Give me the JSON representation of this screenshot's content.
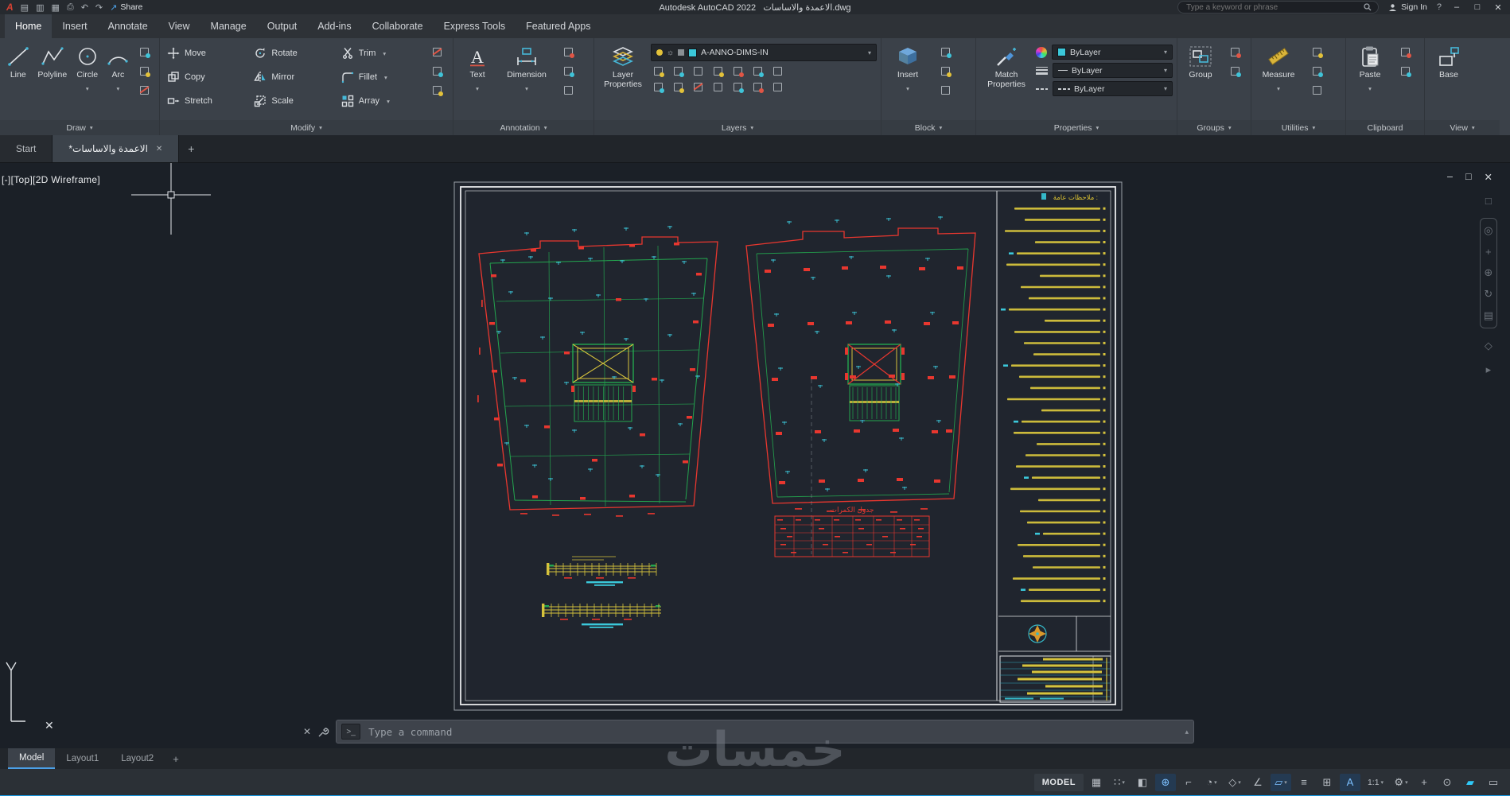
{
  "window": {
    "app_title": "Autodesk AutoCAD 2022",
    "doc_title": "الاعمدة والاساسات.dwg",
    "share_label": "Share",
    "search_placeholder": "Type a keyword or phrase",
    "sign_in_label": "Sign In"
  },
  "glyphs": {
    "close": "✕",
    "minimize": "–",
    "maximize": "□"
  },
  "ribbon_tabs": [
    {
      "label": "Home",
      "active": true
    },
    {
      "label": "Insert"
    },
    {
      "label": "Annotate"
    },
    {
      "label": "View"
    },
    {
      "label": "Manage"
    },
    {
      "label": "Output"
    },
    {
      "label": "Add-ins"
    },
    {
      "label": "Collaborate"
    },
    {
      "label": "Express Tools"
    },
    {
      "label": "Featured Apps"
    }
  ],
  "panels": {
    "draw": {
      "label": "Draw",
      "line": "Line",
      "polyline": "Polyline",
      "circle": "Circle",
      "arc": "Arc"
    },
    "modify": {
      "label": "Modify",
      "buttons": [
        "Move",
        "Rotate",
        "Trim",
        "Copy",
        "Mirror",
        "Fillet",
        "Stretch",
        "Scale",
        "Array"
      ]
    },
    "annotation": {
      "label": "Annotation",
      "text": "Text",
      "dimension": "Dimension"
    },
    "layers": {
      "label": "Layers",
      "layer_properties": "Layer Properties",
      "current_layer": "A-ANNO-DIMS-IN"
    },
    "block": {
      "label": "Block",
      "insert": "Insert"
    },
    "properties": {
      "label": "Properties",
      "match_properties": "Match Properties",
      "color": "ByLayer",
      "lineweight": "ByLayer",
      "linetype": "ByLayer"
    },
    "groups": {
      "label": "Groups",
      "group": "Group"
    },
    "utilities": {
      "label": "Utilities",
      "measure": "Measure"
    },
    "clipboard": {
      "label": "Clipboard",
      "paste": "Paste"
    },
    "view": {
      "label": "View",
      "base": "Base"
    }
  },
  "file_tabs": {
    "start": "Start",
    "document": "*الاعمدة والاساسات",
    "new_tab": "+"
  },
  "viewport": {
    "label": "[-][Top][2D Wireframe]"
  },
  "sheet": {
    "table_title": "جدول الكمرات",
    "notes_title": "ملاحظات عامة :"
  },
  "command_line": {
    "placeholder": "Type a command"
  },
  "layout_tabs": [
    {
      "label": "Model",
      "active": true
    },
    {
      "label": "Layout1"
    },
    {
      "label": "Layout2"
    }
  ],
  "layout_new_tab": "+",
  "statusbar": {
    "model_label": "MODEL",
    "items": [
      {
        "name": "grid-display-icon",
        "glyph": "▦"
      },
      {
        "name": "snap-mode-icon",
        "glyph": "∷",
        "caret": true
      },
      {
        "name": "infer-constraints-icon",
        "glyph": "◧"
      },
      {
        "name": "dynamic-input-icon",
        "glyph": "⊕",
        "active": true
      },
      {
        "name": "ortho-mode-icon",
        "glyph": "⌐"
      },
      {
        "name": "polar-tracking-icon",
        "glyph": "◔",
        "caret": true
      },
      {
        "name": "isometric-drafting-icon",
        "glyph": "◇",
        "caret": true
      },
      {
        "name": "object-snap-tracking-icon",
        "glyph": "∠"
      },
      {
        "name": "object-snap-icon",
        "glyph": "▱",
        "caret": true,
        "active": true
      },
      {
        "name": "lineweight-display-icon",
        "glyph": "≡"
      },
      {
        "name": "selection-cycling-icon",
        "glyph": "⊞"
      },
      {
        "name": "annotation-visibility-icon",
        "glyph": "A",
        "active": true
      },
      {
        "name": "annotation-scale-icon",
        "glyph": "1:1",
        "caret": true,
        "wide": true
      },
      {
        "name": "workspace-switching-icon",
        "glyph": "⚙",
        "caret": true
      },
      {
        "name": "annotation-monitor-icon",
        "glyph": "+"
      },
      {
        "name": "isolate-objects-icon",
        "glyph": "⊙"
      },
      {
        "name": "graphics-performance-icon",
        "glyph": "▰",
        "bright": true
      },
      {
        "name": "clean-screen-icon",
        "glyph": "▭"
      }
    ]
  },
  "watermark": {
    "text": "خمسات"
  },
  "colors": {
    "accent_blue": "#4da2e8",
    "cad_red": "#e8372f",
    "cad_green": "#23a64f",
    "cad_cyan": "#3bc8da",
    "cad_yellow": "#d6c33c",
    "canvas_bg": "#1b2027"
  }
}
